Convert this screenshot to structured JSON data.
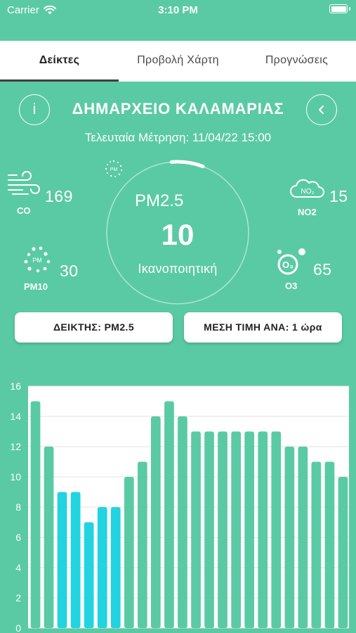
{
  "status_bar": {
    "carrier": "Carrier",
    "time": "3:10 PM"
  },
  "tabs": [
    {
      "label": "Δείκτες",
      "active": true
    },
    {
      "label": "Προβολή Χάρτη",
      "active": false
    },
    {
      "label": "Προγνώσεις",
      "active": false
    }
  ],
  "station": {
    "name": "ΔΗΜΑΡΧΕΙΟ ΚΑΛΑΜΑΡΙΑΣ",
    "last_measurement": "Τελευταία Μέτρηση: 11/04/22 15:00",
    "info_icon_text": "i"
  },
  "gauge": {
    "pollutant": "PM2.5",
    "value": "10",
    "status": "Ικανοποιητική",
    "fill_fraction": 0.1,
    "icon": "pm-particles-icon",
    "icon_text": "PM"
  },
  "pollutants": {
    "co": {
      "name": "CO",
      "value": "169",
      "icon": "wind-icon"
    },
    "no2": {
      "name": "NO2",
      "value": "15",
      "icon": "cloud-no2-icon",
      "icon_text": "NO₂"
    },
    "pm10": {
      "name": "PM10",
      "value": "30",
      "icon": "particles-icon",
      "icon_text": "PM"
    },
    "o3": {
      "name": "O3",
      "value": "65",
      "icon": "ozone-icon",
      "icon_text": "O₃"
    }
  },
  "buttons": {
    "indicator": "ΔΕΙΚΤΗΣ: PM2.5",
    "average": "ΜΕΣΗ ΤΙΜΗ ΑΝΑ: 1 ώρα"
  },
  "colors": {
    "background": "#5acaa4",
    "bar_default": "#5acaa4",
    "bar_highlight": "#22d3e0",
    "chart_bg": "#ffffff"
  },
  "chart_data": {
    "type": "bar",
    "ylim": [
      0,
      16
    ],
    "yticks": [
      0,
      2,
      4,
      6,
      8,
      10,
      12,
      14,
      16
    ],
    "grid": true,
    "values": [
      15,
      12,
      9,
      9,
      7,
      8,
      8,
      10,
      11,
      14,
      15,
      14,
      13,
      13,
      13,
      13,
      13,
      13,
      13,
      12,
      12,
      11,
      11,
      10
    ],
    "highlighted": [
      false,
      false,
      true,
      true,
      true,
      true,
      true,
      false,
      false,
      false,
      false,
      false,
      false,
      false,
      false,
      false,
      false,
      false,
      false,
      false,
      false,
      false,
      false,
      false
    ]
  }
}
